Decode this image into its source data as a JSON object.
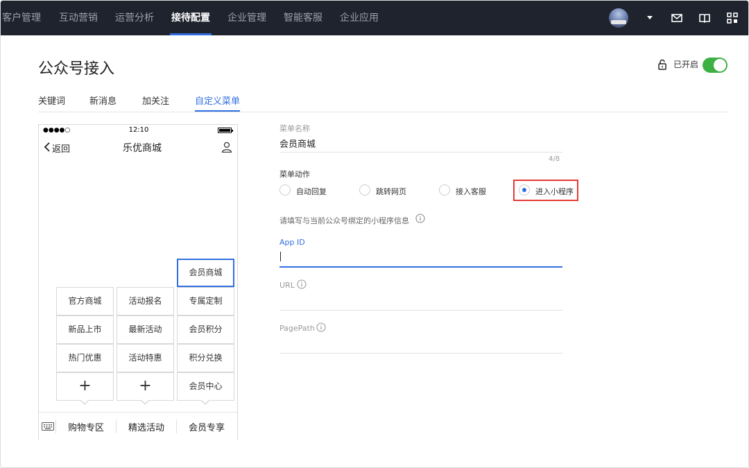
{
  "nav": {
    "items": [
      "客户管理",
      "互动营销",
      "运营分析",
      "接待配置",
      "企业管理",
      "智能客服",
      "企业应用"
    ],
    "active_index": 3,
    "icons": [
      "avatar",
      "chevron-down-icon",
      "mail-icon",
      "book-icon",
      "apps-grid-icon"
    ]
  },
  "header": {
    "title": "公众号接入",
    "status_label": "已开启",
    "toggle_on": true
  },
  "tabs": {
    "items": [
      "关键词",
      "新消息",
      "加关注",
      "自定义菜单"
    ],
    "active_index": 3
  },
  "phone": {
    "status_dots": "●●●●○",
    "time": "12:10",
    "back_label": "返回",
    "title": "乐优商城",
    "selected_item": "会员商城",
    "columns": [
      [
        "官方商城",
        "新品上市",
        "热门优惠",
        "+"
      ],
      [
        "活动报名",
        "最新活动",
        "活动特惠",
        "+"
      ],
      [
        "专属定制",
        "会员积分",
        "积分兑换",
        "会员中心"
      ]
    ],
    "bottom_menu": [
      "购物专区",
      "精选活动",
      "会员专享"
    ]
  },
  "form": {
    "menu_name_label": "菜单名称",
    "menu_name_value": "会员商城",
    "counter": "4/8",
    "action_label": "菜单动作",
    "actions": [
      "自动回复",
      "跳转网页",
      "接入客服",
      "进入小程序"
    ],
    "selected_action_index": 3,
    "hint": "请填写与当前公众号绑定的小程序信息",
    "appid_label": "App ID",
    "appid_value": "",
    "url_label": "URL",
    "url_value": "",
    "pagepath_label": "PagePath",
    "pagepath_value": ""
  },
  "colors": {
    "accent": "#2f6fe0",
    "nav_bg": "#1f232e",
    "toggle_on": "#3cb043",
    "highlight": "#e53935"
  }
}
